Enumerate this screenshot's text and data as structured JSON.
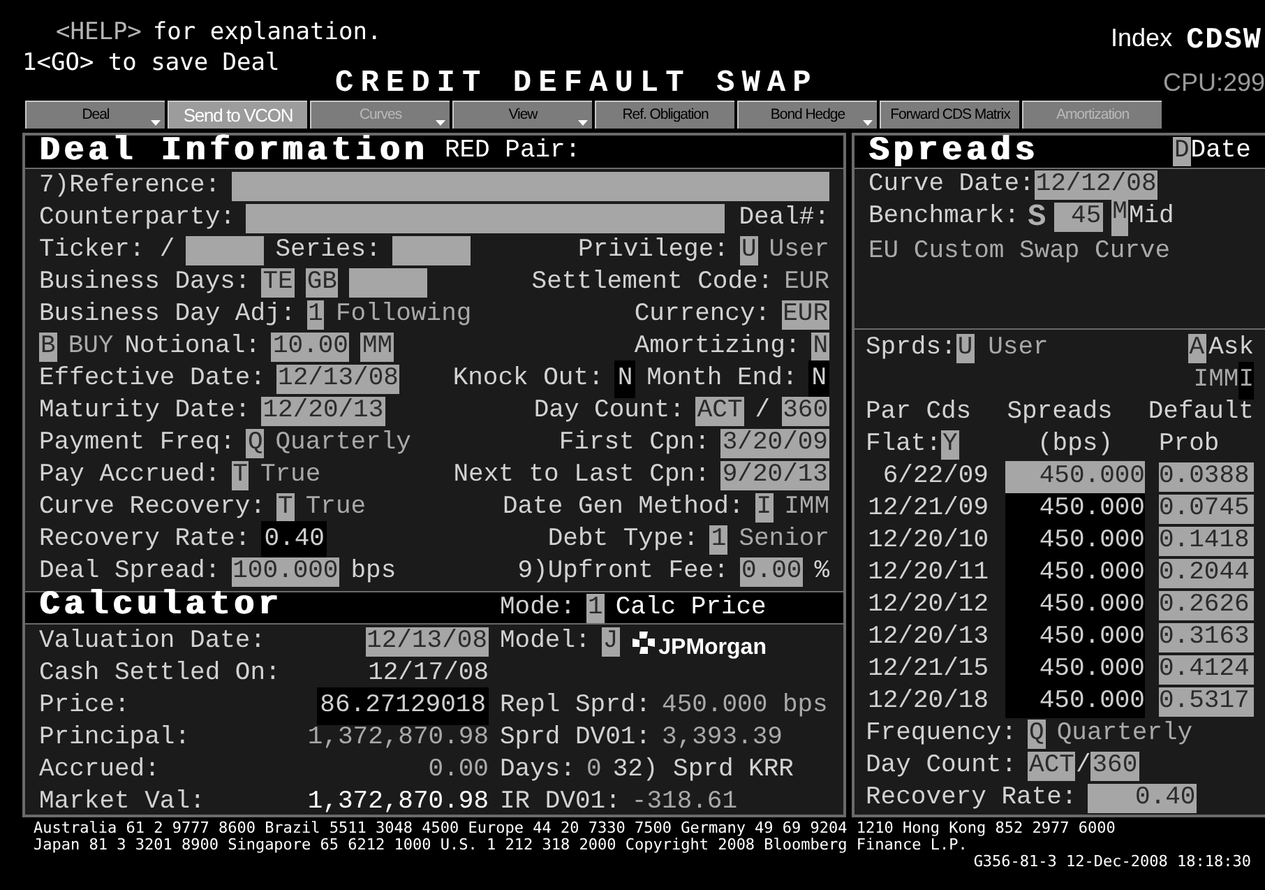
{
  "header": {
    "help_key": "<HELP>",
    "help_text": "for explanation.",
    "go_line": "1<GO> to save Deal",
    "index_label": "Index",
    "index_code": "CDSW",
    "title": "CREDIT DEFAULT SWAP",
    "cpu": "CPU:299"
  },
  "toolbar": [
    {
      "label": "Deal",
      "dropdown": true,
      "disabled": false,
      "highlighted": false
    },
    {
      "label": "Send to VCON",
      "dropdown": false,
      "disabled": false,
      "highlighted": true
    },
    {
      "label": "Curves",
      "dropdown": true,
      "disabled": true,
      "highlighted": false
    },
    {
      "label": "View",
      "dropdown": true,
      "disabled": false,
      "highlighted": false
    },
    {
      "label": "Ref. Obligation",
      "dropdown": false,
      "disabled": false,
      "highlighted": false
    },
    {
      "label": "Bond Hedge",
      "dropdown": true,
      "disabled": false,
      "highlighted": false
    },
    {
      "label": "Forward CDS Matrix",
      "dropdown": false,
      "disabled": false,
      "highlighted": false
    },
    {
      "label": "Amortization",
      "dropdown": false,
      "disabled": true,
      "highlighted": false
    }
  ],
  "deal": {
    "title": "Deal Information",
    "subtitle": "RED Pair:",
    "rows": [
      {
        "left": [
          {
            "kind": "label",
            "text": "7)Reference:"
          },
          {
            "kind": "field",
            "grow": true
          }
        ],
        "right": []
      },
      {
        "left": [
          {
            "kind": "label",
            "text": "Counterparty:"
          },
          {
            "kind": "field",
            "grow": true
          }
        ],
        "right": [
          {
            "kind": "label",
            "text": "Deal#:"
          }
        ]
      },
      {
        "left": [
          {
            "kind": "label",
            "text": "Ticker: /"
          },
          {
            "kind": "field"
          },
          {
            "kind": "label",
            "text": "Series:"
          },
          {
            "kind": "field"
          }
        ],
        "right": [
          {
            "kind": "label",
            "text": "Privilege:"
          },
          {
            "kind": "field",
            "text": "U"
          },
          {
            "kind": "text",
            "text": "User"
          }
        ]
      },
      {
        "left": [
          {
            "kind": "label",
            "text": "Business Days:"
          },
          {
            "kind": "field",
            "text": "TE"
          },
          {
            "kind": "field",
            "text": "GB"
          },
          {
            "kind": "field"
          }
        ],
        "right": [
          {
            "kind": "label",
            "text": "Settlement Code:"
          },
          {
            "kind": "text",
            "text": "EUR"
          }
        ]
      },
      {
        "left": [
          {
            "kind": "label",
            "text": "Business Day Adj:"
          },
          {
            "kind": "field",
            "text": "1"
          },
          {
            "kind": "text",
            "text": "Following"
          }
        ],
        "right": [
          {
            "kind": "label",
            "text": "Currency:"
          },
          {
            "kind": "field",
            "text": "EUR"
          }
        ]
      },
      {
        "left": [
          {
            "kind": "field",
            "text": "B"
          },
          {
            "kind": "text",
            "text": "BUY"
          },
          {
            "kind": "label",
            "text": "Notional:"
          },
          {
            "kind": "field",
            "text": "10.00"
          },
          {
            "kind": "field",
            "text": "MM"
          }
        ],
        "right": [
          {
            "kind": "label",
            "text": "Amortizing:"
          },
          {
            "kind": "field",
            "text": "N"
          }
        ]
      },
      {
        "left": [
          {
            "kind": "label",
            "text": "Effective Date:"
          },
          {
            "kind": "field",
            "text": "12/13/08"
          }
        ],
        "right": [
          {
            "kind": "label",
            "text": "Knock Out:"
          },
          {
            "kind": "dark",
            "text": "N"
          },
          {
            "kind": "label",
            "text": "Month End:"
          },
          {
            "kind": "dark",
            "text": "N"
          }
        ]
      },
      {
        "left": [
          {
            "kind": "label",
            "text": "Maturity Date:"
          },
          {
            "kind": "field",
            "text": "12/20/13"
          }
        ],
        "right": [
          {
            "kind": "label",
            "text": "Day Count:"
          },
          {
            "kind": "field",
            "text": "ACT"
          },
          {
            "kind": "label",
            "text": "/"
          },
          {
            "kind": "field",
            "text": "360"
          }
        ]
      },
      {
        "left": [
          {
            "kind": "label",
            "text": "Payment Freq:"
          },
          {
            "kind": "field",
            "text": "Q"
          },
          {
            "kind": "text",
            "text": "Quarterly"
          }
        ],
        "right": [
          {
            "kind": "label",
            "text": "First Cpn:"
          },
          {
            "kind": "field",
            "text": "3/20/09"
          }
        ]
      },
      {
        "left": [
          {
            "kind": "label",
            "text": "Pay Accrued:"
          },
          {
            "kind": "field",
            "text": "T"
          },
          {
            "kind": "text",
            "text": "True"
          }
        ],
        "right": [
          {
            "kind": "label",
            "text": "Next to Last Cpn:"
          },
          {
            "kind": "field",
            "text": "9/20/13"
          }
        ]
      },
      {
        "left": [
          {
            "kind": "label",
            "text": "Curve Recovery:"
          },
          {
            "kind": "field",
            "text": "T"
          },
          {
            "kind": "text",
            "text": "True"
          }
        ],
        "right": [
          {
            "kind": "label",
            "text": "Date Gen Method:"
          },
          {
            "kind": "field",
            "text": "I"
          },
          {
            "kind": "text",
            "text": "IMM"
          }
        ]
      },
      {
        "left": [
          {
            "kind": "label",
            "text": "Recovery Rate:"
          },
          {
            "kind": "dark",
            "text": "0.40"
          }
        ],
        "right": [
          {
            "kind": "label",
            "text": "Debt Type:"
          },
          {
            "kind": "field",
            "text": "1"
          },
          {
            "kind": "text",
            "text": "Senior"
          }
        ]
      },
      {
        "left": [
          {
            "kind": "label",
            "text": "Deal Spread:"
          },
          {
            "kind": "field",
            "text": "100.000"
          },
          {
            "kind": "label",
            "text": "bps"
          }
        ],
        "right": [
          {
            "kind": "label",
            "text": "9)Upfront Fee:"
          },
          {
            "kind": "field",
            "text": "0.00"
          },
          {
            "kind": "label",
            "text": "%"
          }
        ]
      }
    ]
  },
  "calculator": {
    "title": "Calculator",
    "mode_label": "Mode:",
    "mode_code": "1",
    "mode_value": "Calc Price",
    "rows": [
      {
        "label": "Valuation Date:",
        "value": {
          "kind": "field",
          "text": "12/13/08"
        },
        "right": [
          {
            "kind": "label",
            "text": "Model:"
          },
          {
            "kind": "field",
            "text": "J"
          },
          {
            "kind": "logo",
            "text": "JPMorgan"
          }
        ]
      },
      {
        "label": "Cash Settled On:",
        "value": {
          "kind": "label",
          "text": "12/17/08"
        },
        "right": []
      },
      {
        "label": "Price:",
        "value": {
          "kind": "dark",
          "text": "86.27129018"
        },
        "right": [
          {
            "kind": "label",
            "text": "Repl Sprd:"
          },
          {
            "kind": "text",
            "text": "450.000 bps"
          }
        ]
      },
      {
        "label": "Principal:",
        "value": {
          "kind": "text",
          "text": "1,372,870.98"
        },
        "right": [
          {
            "kind": "label",
            "text": "Sprd DV01:"
          },
          {
            "kind": "text",
            "text": "3,393.39"
          }
        ]
      },
      {
        "label": "Accrued:",
        "value": {
          "kind": "text",
          "text": "0.00"
        },
        "right": [
          {
            "kind": "label",
            "text": "Days:"
          },
          {
            "kind": "text",
            "text": "0"
          },
          {
            "kind": "label",
            "text": "32) Sprd KRR"
          }
        ]
      },
      {
        "label": "Market Val:",
        "value": {
          "kind": "bright",
          "text": "1,372,870.98"
        },
        "right": [
          {
            "kind": "label",
            "text": "IR DV01:"
          },
          {
            "kind": "text",
            "text": "-318.61"
          }
        ]
      }
    ]
  },
  "spreads": {
    "title": "Spreads",
    "type_code": "D",
    "type_label": "Date",
    "curve_date_label": "Curve Date:",
    "curve_date": "12/12/08",
    "benchmark_label": "Benchmark:",
    "benchmark_symbol": "S",
    "benchmark_code": "45",
    "side_code": "M",
    "side_label": "Mid",
    "curve_name": "EU Custom Swap Curve",
    "source_label": "Sprds:",
    "source_code": "U",
    "source_value": "User",
    "quote_code": "A",
    "quote_label": "Ask",
    "schedule_label": "IMM",
    "schedule_code": "I",
    "columns": [
      "Par Cds",
      "Spreads",
      "Default"
    ],
    "flat_label": "Flat:",
    "flat_code": "Y",
    "columns_sub": [
      "(bps)",
      "Prob"
    ],
    "rows": [
      {
        "date": "6/22/09",
        "spread": "450.000",
        "prob": "0.0388",
        "editable": true
      },
      {
        "date": "12/21/09",
        "spread": "450.000",
        "prob": "0.0745",
        "editable": false
      },
      {
        "date": "12/20/10",
        "spread": "450.000",
        "prob": "0.1418",
        "editable": false
      },
      {
        "date": "12/20/11",
        "spread": "450.000",
        "prob": "0.2044",
        "editable": false
      },
      {
        "date": "12/20/12",
        "spread": "450.000",
        "prob": "0.2626",
        "editable": false
      },
      {
        "date": "12/20/13",
        "spread": "450.000",
        "prob": "0.3163",
        "editable": false
      },
      {
        "date": "12/21/15",
        "spread": "450.000",
        "prob": "0.4124",
        "editable": false
      },
      {
        "date": "12/20/18",
        "spread": "450.000",
        "prob": "0.5317",
        "editable": false
      }
    ],
    "frequency_label": "Frequency:",
    "frequency_code": "Q",
    "frequency_value": "Quarterly",
    "day_count_label": "Day Count:",
    "day_count_a": "ACT",
    "day_count_sep": "/",
    "day_count_b": "360",
    "recovery_label": "Recovery Rate:",
    "recovery_value": "0.40"
  },
  "footer": [
    "Australia 61 2 9777 8600 Brazil 5511 3048 4500 Europe 44 20 7330 7500 Germany 49 69 9204 1210 Hong Kong 852 2977 6000",
    "Japan 81 3 3201 8900 Singapore 65 6212 1000 U.S. 1 212 318 2000 Copyright 2008 Bloomberg Finance L.P.",
    "G356-81-3 12-Dec-2008 18:18:30"
  ]
}
